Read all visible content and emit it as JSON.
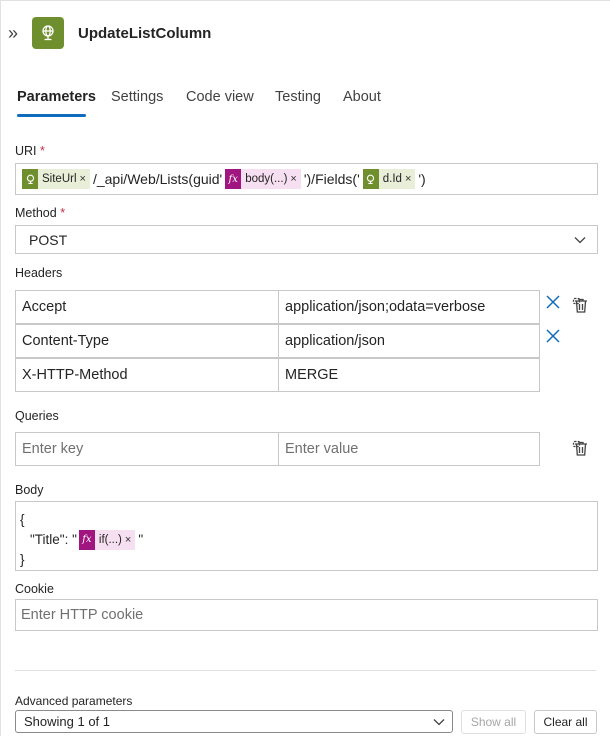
{
  "header": {
    "title": "UpdateListColumn",
    "collapse_glyph": "»",
    "icon": "globe-icon",
    "icon_bg": "#6f8f2e"
  },
  "tabs": [
    {
      "label": "Parameters",
      "active": true
    },
    {
      "label": "Settings",
      "active": false
    },
    {
      "label": "Code view",
      "active": false
    },
    {
      "label": "Testing",
      "active": false
    },
    {
      "label": "About",
      "active": false
    }
  ],
  "uri": {
    "label": "URI",
    "required_mark": "*",
    "token1": "SiteUrl",
    "text1": "/_api/Web/Lists(guid'",
    "token2": "body(...)",
    "text2": "')/Fields('",
    "token3": "d.Id",
    "text3": "')"
  },
  "method": {
    "label": "Method",
    "required_mark": "*",
    "value": "POST"
  },
  "headers": {
    "label": "Headers",
    "rows": [
      {
        "key": "Accept",
        "value": "application/json;odata=verbose"
      },
      {
        "key": "Content-Type",
        "value": "application/json"
      },
      {
        "key": "X-HTTP-Method",
        "value": "MERGE"
      }
    ]
  },
  "queries": {
    "label": "Queries",
    "key_placeholder": "Enter key",
    "value_placeholder": "Enter value"
  },
  "body": {
    "label": "Body",
    "line1": "{",
    "line2_prefix": "\"Title\": \"",
    "token": "if(...)",
    "line2_suffix": "\"",
    "line3": "}"
  },
  "cookie": {
    "label": "Cookie",
    "placeholder": "Enter HTTP cookie"
  },
  "advanced": {
    "label": "Advanced parameters",
    "value": "Showing 1 of 1",
    "show_all": "Show all",
    "clear_all": "Clear all"
  },
  "colors": {
    "accent": "#0f6cbd",
    "token_green": "#6f8f2e",
    "token_fx": "#a0157f",
    "required": "#c4314b"
  },
  "token_fx_glyph": "fx",
  "remove_glyph": "×"
}
